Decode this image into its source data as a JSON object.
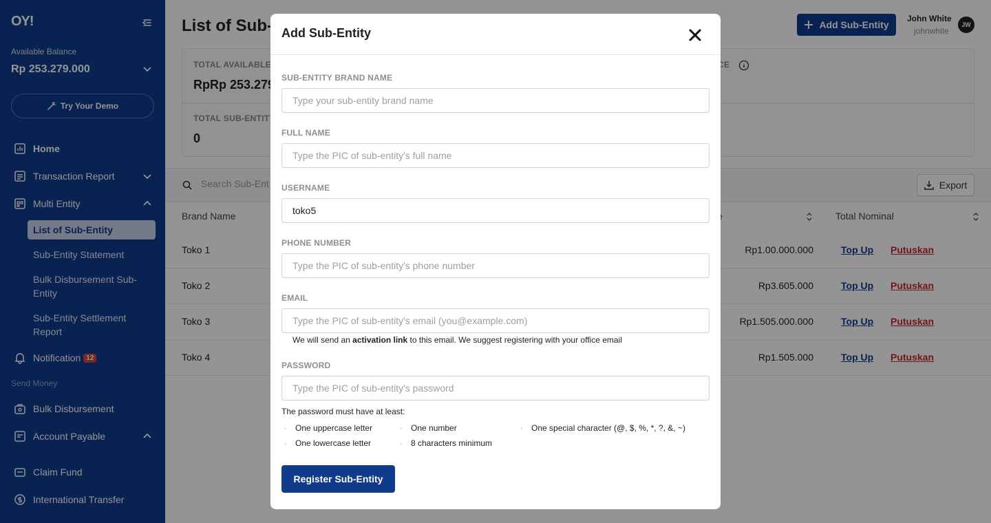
{
  "sidebar": {
    "logo": "OY!",
    "balance_label": "Available Balance",
    "balance_value": "Rp 253.279.000",
    "demo_button": "Try Your Demo",
    "nav": {
      "home": "Home",
      "transaction_report": "Transaction Report",
      "multi_entity": "Multi Entity",
      "list_sub_entity": "List of Sub-Entity",
      "sub_entity_statement": "Sub-Entity Statement",
      "bulk_disbursement_sub_entity": "Bulk Disbursement Sub-Entity",
      "sub_entity_settlement_report": "Sub-Entity Settlement Report",
      "notification": "Notification",
      "notification_count": "12",
      "send_money_label": "Send Money",
      "bulk_disbursement": "Bulk Disbursement",
      "account_payable": "Account Payable",
      "claim_fund": "Claim Fund",
      "international_transfer": "International Transfer"
    }
  },
  "header": {
    "title": "List of Sub-E",
    "add_button": "Add Sub-Entity",
    "user_name": "John White",
    "user_handle": "johnwhite",
    "user_initials": "JW"
  },
  "stats": {
    "total_available_label": "TOTAL AVAILABLE B",
    "total_available_value": "RpRp 253.279",
    "balance_label_right": "CE",
    "total_sub_entity_label": "TOTAL SUB-ENTITY",
    "total_sub_entity_value": "0"
  },
  "table": {
    "search_placeholder": "Search Sub-Ent",
    "export_label": "Export",
    "columns": {
      "brand": "Brand Name",
      "balance_partial": "e",
      "total_nominal": "Total Nominal"
    },
    "rows": [
      {
        "brand": "Toko 1",
        "balance": "Rp1.00.000.000",
        "topup": "Top Up",
        "cut": "Putuskan"
      },
      {
        "brand": "Toko 2",
        "balance": "Rp3.605.000",
        "topup": "Top Up",
        "cut": "Putuskan"
      },
      {
        "brand": "Toko 3",
        "balance": "Rp1.505.000.000",
        "topup": "Top Up",
        "cut": "Putuskan"
      },
      {
        "brand": "Toko 4",
        "balance": "Rp1.505.000",
        "topup": "Top Up",
        "cut": "Putuskan"
      }
    ]
  },
  "modal": {
    "title": "Add Sub-Entity",
    "fields": {
      "brand_label": "SUB-ENTITY BRAND NAME",
      "brand_placeholder": "Type your sub-entity brand name",
      "brand_value": "",
      "full_name_label": "FULL NAME",
      "full_name_placeholder": "Type the PIC of sub-entity's full name",
      "full_name_value": "",
      "username_label": "USERNAME",
      "username_placeholder": "",
      "username_value": "toko5",
      "phone_label": "PHONE NUMBER",
      "phone_placeholder": "Type the PIC of sub-entity's phone number",
      "phone_value": "",
      "email_label": "EMAIL",
      "email_placeholder": "Type the PIC of sub-entity's email (you@example.com)",
      "email_value": "",
      "email_hint_pre": "We will send an ",
      "email_hint_bold": "activation link",
      "email_hint_post": " to this email. We suggest registering with your office email",
      "password_label": "PASSWORD",
      "password_placeholder": "Type the PIC of sub-entity's password",
      "password_value": ""
    },
    "password_rules_title": "The password must have at least:",
    "password_rules": [
      "One uppercase letter",
      "One number",
      "One special character (@, $, %, *, ?, &, ~)",
      "One lowercase letter",
      "8 characters minimum"
    ],
    "register_button": "Register Sub-Entity"
  },
  "colors": {
    "brand": "#0f3b8c",
    "danger": "#c3262c",
    "badge": "#d4433c"
  }
}
